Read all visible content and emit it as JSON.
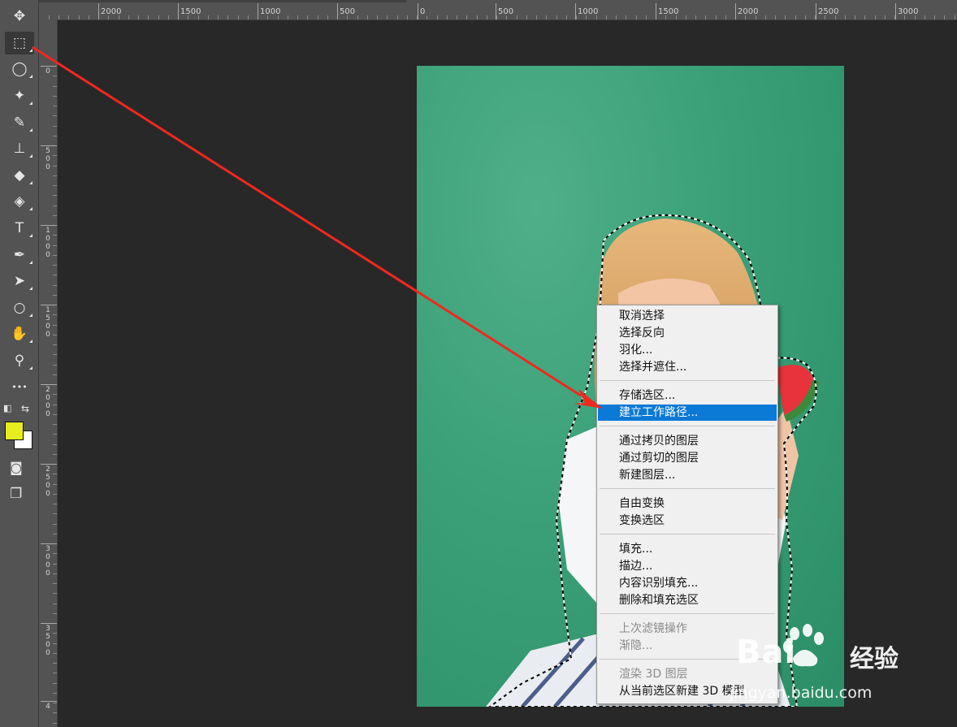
{
  "colors": {
    "foreground": "#e6ee1e",
    "background": "#ffffff",
    "highlight": "#0b79d6",
    "arrow": "#f0281e"
  },
  "toolbar": {
    "tools": [
      {
        "name": "move-tool",
        "icon": "move-icon",
        "glyph": "✥"
      },
      {
        "name": "rectangular-marquee-tool",
        "icon": "marquee-icon",
        "glyph": "⬚",
        "active": true
      },
      {
        "name": "lasso-tool",
        "icon": "lasso-icon",
        "glyph": "◯"
      },
      {
        "name": "magic-wand-tool",
        "icon": "magic-wand-icon",
        "glyph": "✦"
      },
      {
        "name": "brush-tool",
        "icon": "brush-icon",
        "glyph": "✎"
      },
      {
        "name": "clone-stamp-tool",
        "icon": "stamp-icon",
        "glyph": "⊥"
      },
      {
        "name": "eraser-tool",
        "icon": "eraser-icon",
        "glyph": "◆"
      },
      {
        "name": "paint-bucket-tool",
        "icon": "paint-bucket-icon",
        "glyph": "◈"
      },
      {
        "name": "type-tool",
        "icon": "type-icon",
        "glyph": "T"
      },
      {
        "name": "pen-tool",
        "icon": "pen-icon",
        "glyph": "✒"
      },
      {
        "name": "path-selection-tool",
        "icon": "arrow-cursor-icon",
        "glyph": "➤"
      },
      {
        "name": "ellipse-tool",
        "icon": "ellipse-icon",
        "glyph": "○"
      },
      {
        "name": "hand-tool",
        "icon": "hand-icon",
        "glyph": "✋"
      },
      {
        "name": "zoom-tool",
        "icon": "zoom-icon",
        "glyph": "⚲"
      },
      {
        "name": "more-tools",
        "icon": "ellipsis-icon",
        "glyph": "•••"
      }
    ]
  },
  "ruler": {
    "top_labels": [
      "2000",
      "1500",
      "1000",
      "500",
      "0",
      "500",
      "1000",
      "1500",
      "2000",
      "2500",
      "3000"
    ],
    "left_labels": [
      "0",
      "500",
      "1000",
      "1500",
      "2000",
      "2500",
      "3000",
      "3500",
      "4"
    ]
  },
  "context_menu": {
    "groups": [
      [
        "取消选择",
        "选择反向",
        "羽化...",
        "选择并遮住..."
      ],
      [
        "存储选区...",
        "建立工作路径..."
      ],
      [
        "通过拷贝的图层",
        "通过剪切的图层",
        "新建图层..."
      ],
      [
        "自由变换",
        "变换选区"
      ],
      [
        "填充...",
        "描边...",
        "内容识别填充...",
        "删除和填充选区"
      ],
      [
        "上次滤镜操作",
        "渐隐..."
      ],
      [
        "渲染 3D 图层",
        "从当前选区新建 3D 模型"
      ]
    ],
    "highlighted": "建立工作路径...",
    "disabled": [
      "上次滤镜操作",
      "渐隐...",
      "渲染 3D 图层"
    ]
  },
  "watermark": {
    "logo": "Bai",
    "logo_suffix": "经验",
    "url": "jingyan.baidu.com"
  }
}
